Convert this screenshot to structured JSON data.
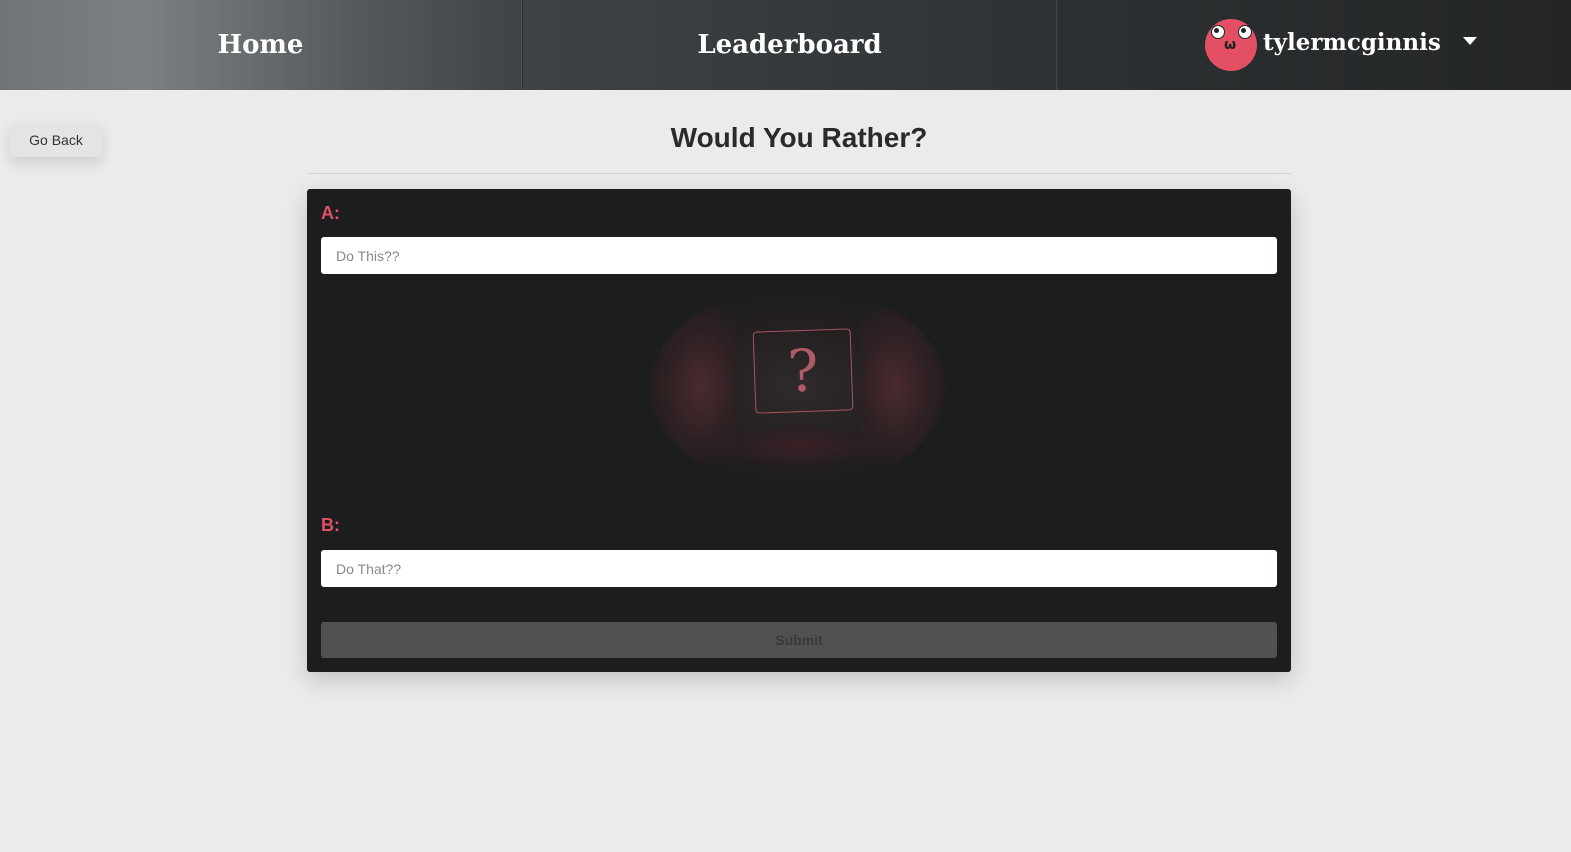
{
  "nav": {
    "home_label": "Home",
    "leaderboard_label": "Leaderboard",
    "username": "tylermcginnis",
    "avatar_color": "#e35064"
  },
  "go_back_label": "Go Back",
  "page_title": "Would You Rather?",
  "form": {
    "option_a": {
      "label": "A:",
      "value": "",
      "placeholder": "Do This??"
    },
    "option_b": {
      "label": "B:",
      "value": "",
      "placeholder": "Do That??"
    },
    "hero_icon": "question-mark-box",
    "submit_label": "Submit",
    "submit_disabled": true
  },
  "colors": {
    "accent": "#e35064",
    "card_bg": "#1c1d1f",
    "page_bg": "#ebebeb"
  }
}
